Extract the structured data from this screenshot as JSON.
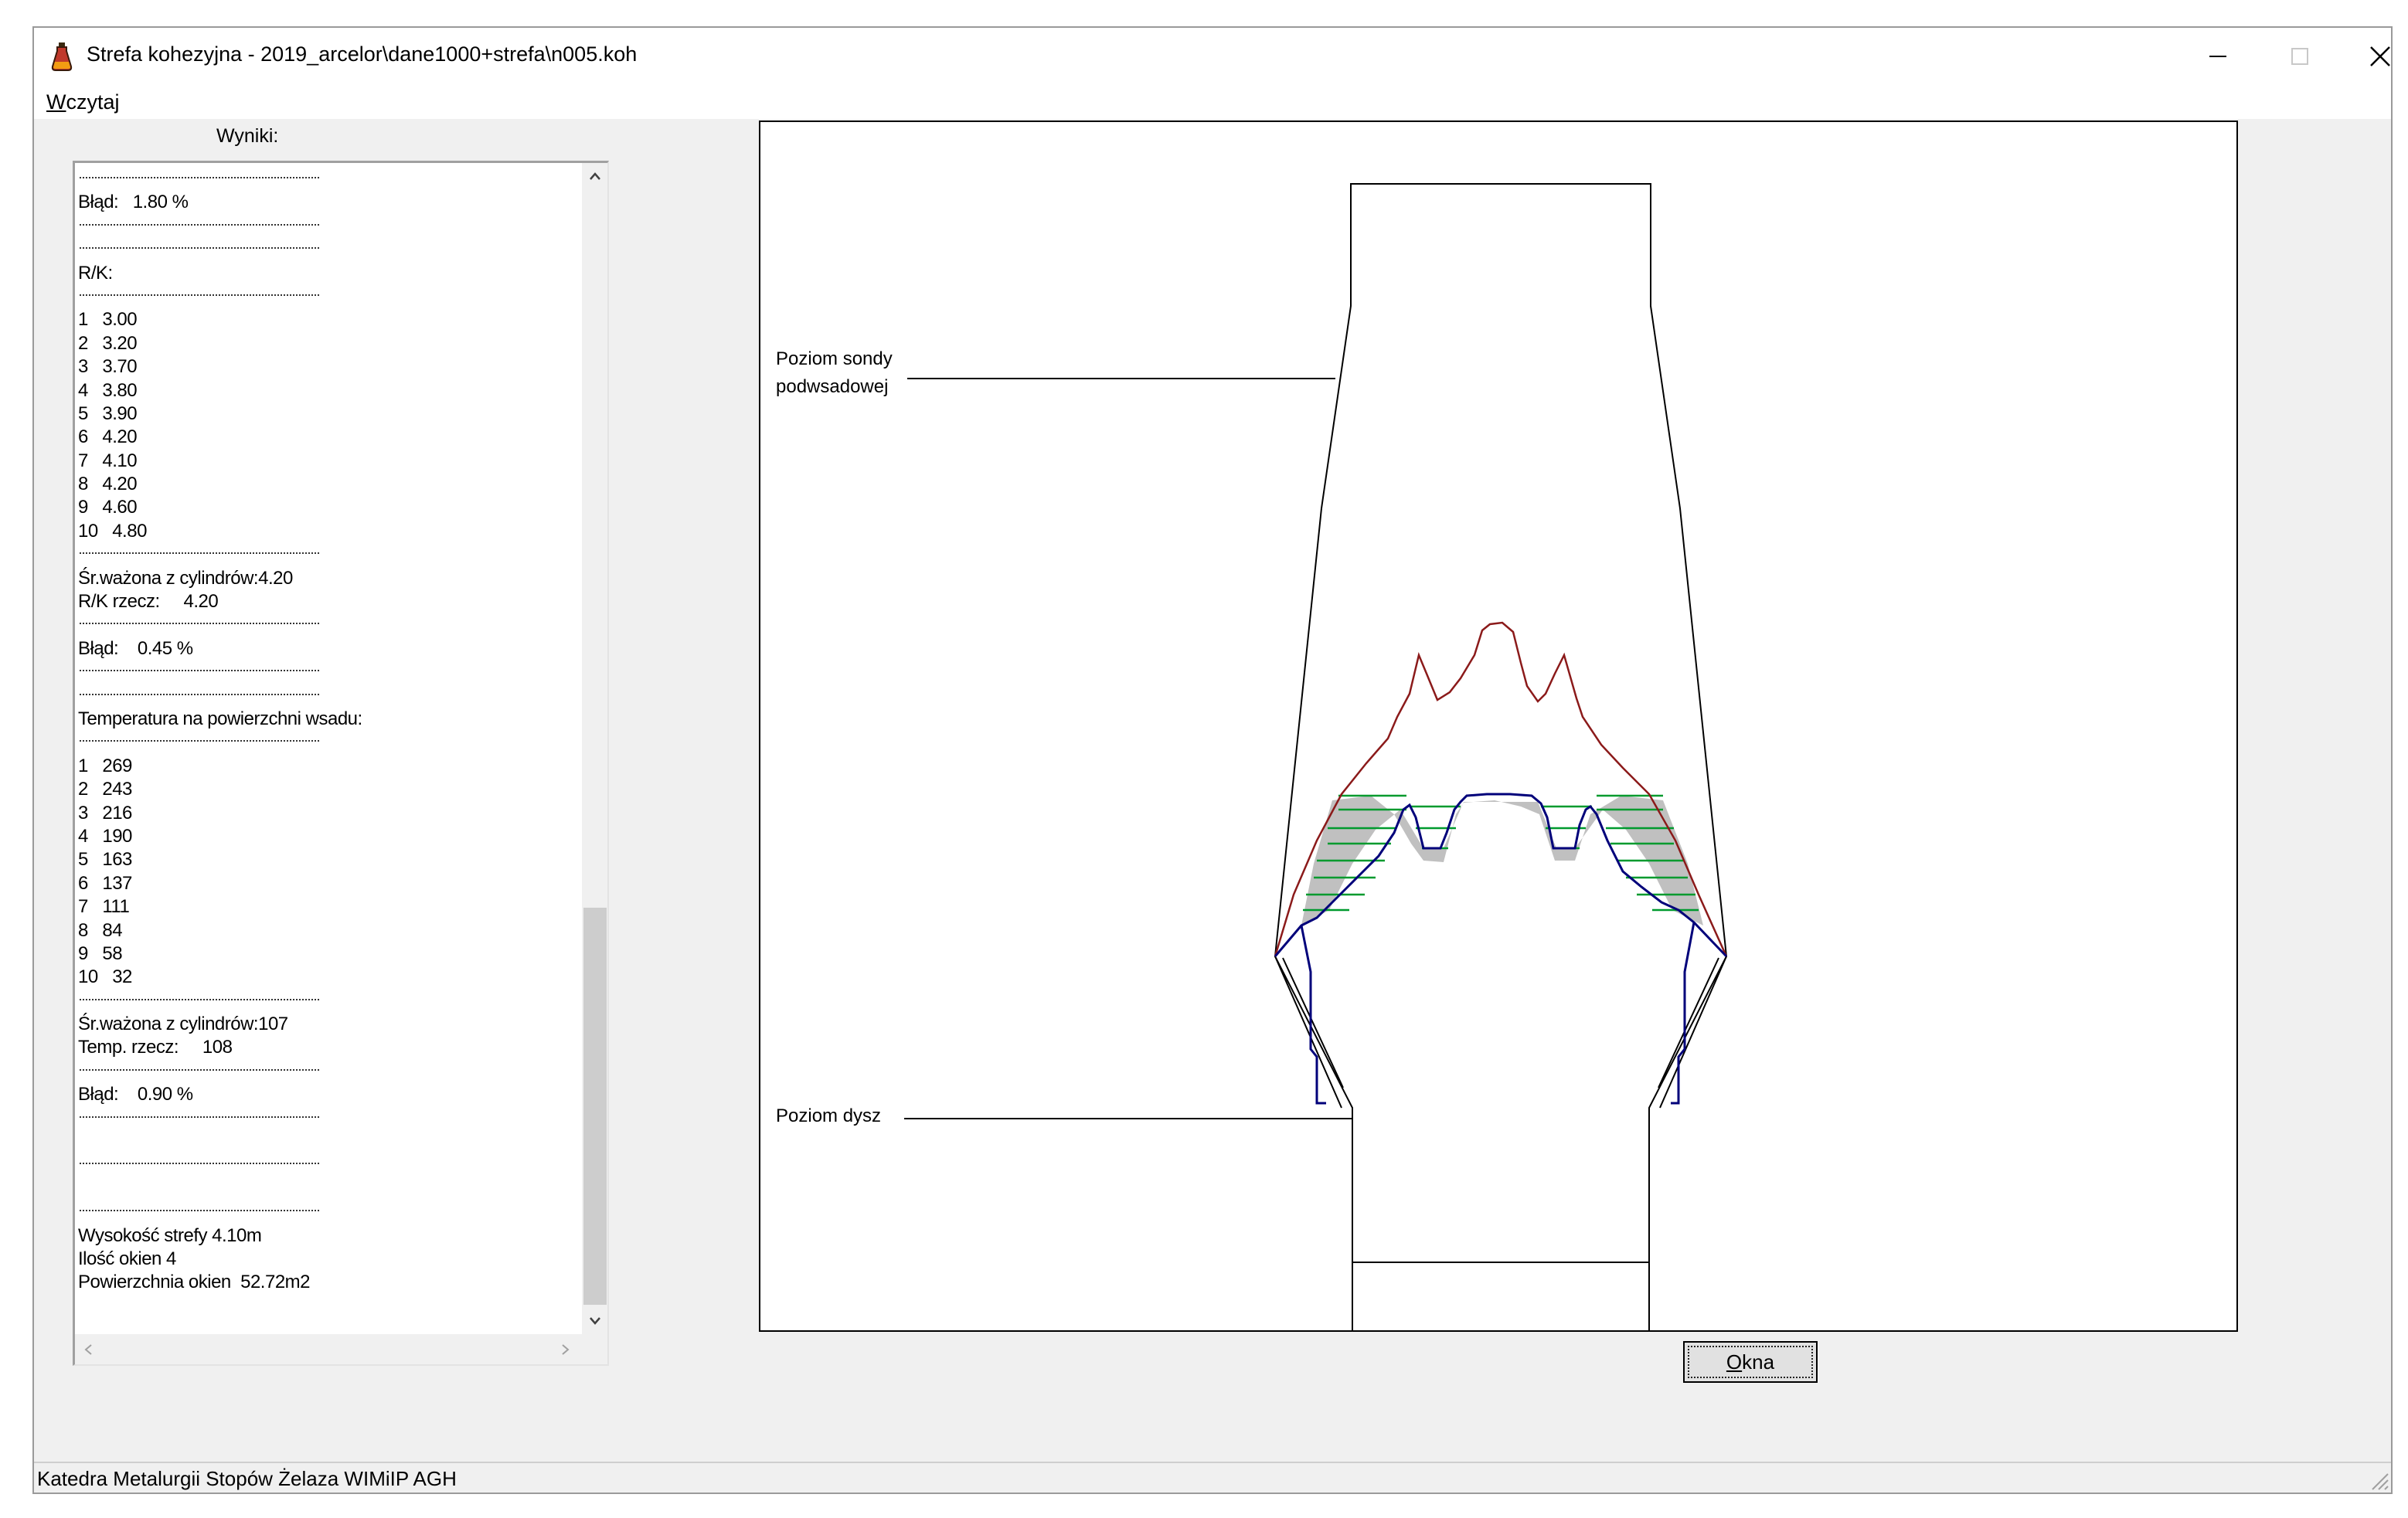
{
  "window": {
    "title": "Strefa kohezyjna - 2019_arcelor\\dane1000+strefa\\n005.koh",
    "controls": {
      "minimize": "minimize",
      "maximize": "maximize",
      "close": "close"
    }
  },
  "menu": {
    "items": [
      {
        "label_first": "W",
        "label_rest": "czytaj"
      }
    ]
  },
  "results": {
    "label": "Wyniki:",
    "lines": [
      {
        "type": "sep"
      },
      {
        "type": "text",
        "text": "Błąd:   1.80 %"
      },
      {
        "type": "sep"
      },
      {
        "type": "sep"
      },
      {
        "type": "text",
        "text": "R/K:"
      },
      {
        "type": "sep"
      },
      {
        "type": "text",
        "text": "1   3.00"
      },
      {
        "type": "text",
        "text": "2   3.20"
      },
      {
        "type": "text",
        "text": "3   3.70"
      },
      {
        "type": "text",
        "text": "4   3.80"
      },
      {
        "type": "text",
        "text": "5   3.90"
      },
      {
        "type": "text",
        "text": "6   4.20"
      },
      {
        "type": "text",
        "text": "7   4.10"
      },
      {
        "type": "text",
        "text": "8   4.20"
      },
      {
        "type": "text",
        "text": "9   4.60"
      },
      {
        "type": "text",
        "text": "10   4.80"
      },
      {
        "type": "sep"
      },
      {
        "type": "text",
        "text": "Śr.ważona z cylindrów:4.20"
      },
      {
        "type": "text",
        "text": "R/K rzecz:     4.20"
      },
      {
        "type": "sep"
      },
      {
        "type": "text",
        "text": "Błąd:    0.45 %"
      },
      {
        "type": "sep"
      },
      {
        "type": "sep"
      },
      {
        "type": "text",
        "text": "Temperatura na powierzchni wsadu:"
      },
      {
        "type": "sep"
      },
      {
        "type": "text",
        "text": "1   269"
      },
      {
        "type": "text",
        "text": "2   243"
      },
      {
        "type": "text",
        "text": "3   216"
      },
      {
        "type": "text",
        "text": "4   190"
      },
      {
        "type": "text",
        "text": "5   163"
      },
      {
        "type": "text",
        "text": "6   137"
      },
      {
        "type": "text",
        "text": "7   111"
      },
      {
        "type": "text",
        "text": "8   84"
      },
      {
        "type": "text",
        "text": "9   58"
      },
      {
        "type": "text",
        "text": "10   32"
      },
      {
        "type": "sep"
      },
      {
        "type": "text",
        "text": "Śr.ważona z cylindrów:107"
      },
      {
        "type": "text",
        "text": "Temp. rzecz:     108"
      },
      {
        "type": "sep"
      },
      {
        "type": "text",
        "text": "Błąd:    0.90 %"
      },
      {
        "type": "sep"
      },
      {
        "type": "text",
        "text": ""
      },
      {
        "type": "sep"
      },
      {
        "type": "text",
        "text": ""
      },
      {
        "type": "sep"
      },
      {
        "type": "text",
        "text": "Wysokość strefy 4.10m"
      },
      {
        "type": "text",
        "text": "Ilość okien 4"
      },
      {
        "type": "text",
        "text": "Powierzchnia okien  52.72m2"
      }
    ]
  },
  "drawing": {
    "probe_label_line1": "Poziom sondy",
    "probe_label_line2": "podwsadowej",
    "tuyere_label": "Poziom dysz",
    "colors": {
      "outline": "#000000",
      "upper_boundary": "#8b1a1a",
      "lower_boundary": "#00007a",
      "windows": "#009a2e",
      "fill": "#c0c0c0"
    }
  },
  "buttons": {
    "okna_first": "O",
    "okna_rest": "kna"
  },
  "statusbar": {
    "text": "Katedra Metalurgii Stopów Żelaza WIMiIP AGH"
  }
}
